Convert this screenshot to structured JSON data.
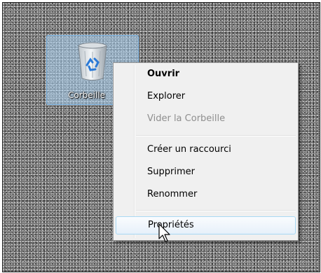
{
  "desktop": {
    "icon": {
      "label": "Corbeille",
      "icon": "recycle-bin-icon"
    }
  },
  "context_menu": {
    "items": [
      {
        "label": "Ouvrir",
        "bold": true,
        "enabled": true
      },
      {
        "label": "Explorer",
        "enabled": true
      },
      {
        "label": "Vider la Corbeille",
        "enabled": false
      },
      {
        "label": "Créer un raccourci",
        "enabled": true
      },
      {
        "label": "Supprimer",
        "enabled": true
      },
      {
        "label": "Renommer",
        "enabled": true
      },
      {
        "label": "Propriétés",
        "enabled": true,
        "hovered": true
      }
    ]
  },
  "colors": {
    "hover_border": "#a8d8f3",
    "disabled_text": "#8e8e8e",
    "selection_fill": "#add6f5"
  }
}
